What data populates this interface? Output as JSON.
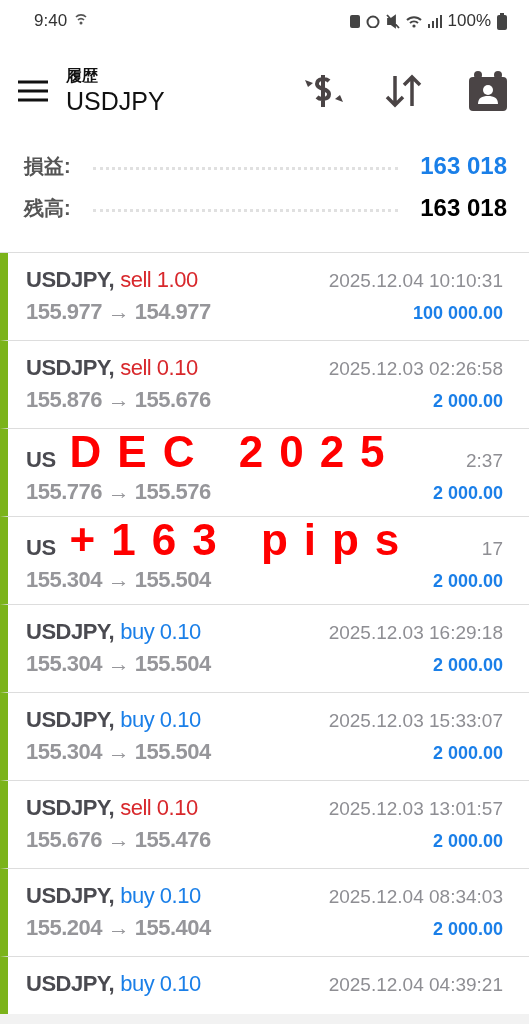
{
  "status_bar": {
    "time": "9:40",
    "battery": "100%"
  },
  "header": {
    "subtitle": "履歴",
    "title": "USDJPY"
  },
  "summary": [
    {
      "label": "損益:",
      "value": "163 018",
      "kind": "profit"
    },
    {
      "label": "残高:",
      "value": "163 018",
      "kind": "balance"
    }
  ],
  "deals": [
    {
      "symbol": "USDJPY,",
      "kind": "sell",
      "type": "sell 1.00",
      "prices": "155.977 → 154.977",
      "time": "2025.12.04 10:10:31",
      "profit": "100 000.00"
    },
    {
      "symbol": "USDJPY,",
      "kind": "sell",
      "type": "sell 0.10",
      "prices": "155.876 → 155.676",
      "time": "2025.12.03 02:26:58",
      "profit": "2 000.00"
    },
    {
      "symbol": "US",
      "caption": "DEC 2025",
      "prices": "155.776 → 155.576",
      "time": "2:37",
      "profit": "2 000.00"
    },
    {
      "symbol": "US",
      "caption": "+163 pips",
      "prices": "155.304 → 155.504",
      "time": "17",
      "profit": "2 000.00"
    },
    {
      "symbol": "USDJPY,",
      "kind": "buy",
      "type": "buy 0.10",
      "prices": "155.304 → 155.504",
      "time": "2025.12.03 16:29:18",
      "profit": "2 000.00"
    },
    {
      "symbol": "USDJPY,",
      "kind": "buy",
      "type": "buy 0.10",
      "prices": "155.304 → 155.504",
      "time": "2025.12.03 15:33:07",
      "profit": "2 000.00"
    },
    {
      "symbol": "USDJPY,",
      "kind": "sell",
      "type": "sell 0.10",
      "prices": "155.676 → 155.476",
      "time": "2025.12.03 13:01:57",
      "profit": "2 000.00"
    },
    {
      "symbol": "USDJPY,",
      "kind": "buy",
      "type": "buy 0.10",
      "prices": "155.204 → 155.404",
      "time": "2025.12.04 08:34:03",
      "profit": "2 000.00"
    },
    {
      "symbol": "USDJPY,",
      "kind": "buy",
      "type": "buy 0.10",
      "time": "2025.12.04 04:39:21"
    }
  ]
}
